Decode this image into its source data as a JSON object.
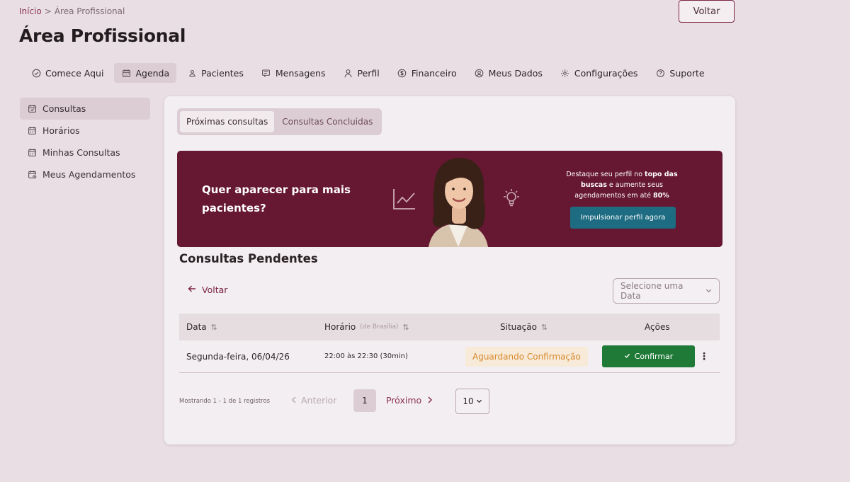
{
  "breadcrumb": {
    "home": "Início",
    "sep": ">",
    "current": "Área Profissional"
  },
  "header": {
    "title": "Área Profissional",
    "back_button": "Voltar"
  },
  "topnav": [
    {
      "label": "Comece Aqui",
      "icon": "check-circle-icon"
    },
    {
      "label": "Agenda",
      "icon": "calendar-icon",
      "active": true
    },
    {
      "label": "Pacientes",
      "icon": "user-icon"
    },
    {
      "label": "Mensagens",
      "icon": "message-icon"
    },
    {
      "label": "Perfil",
      "icon": "profile-icon"
    },
    {
      "label": "Financeiro",
      "icon": "dollar-icon"
    },
    {
      "label": "Meus Dados",
      "icon": "user-circle-icon"
    },
    {
      "label": "Configurações",
      "icon": "gear-icon"
    },
    {
      "label": "Suporte",
      "icon": "help-icon"
    }
  ],
  "sidebar": [
    {
      "label": "Consultas",
      "icon": "calendar-check-icon",
      "active": true
    },
    {
      "label": "Horários",
      "icon": "calendar-icon"
    },
    {
      "label": "Minhas Consultas",
      "icon": "calendar-icon"
    },
    {
      "label": "Meus Agendamentos",
      "icon": "calendar-clock-icon"
    }
  ],
  "tabs": [
    {
      "label": "Próximas consultas",
      "active": true
    },
    {
      "label": "Consultas Concluidas"
    }
  ],
  "banner": {
    "headline": "Quer aparecer para mais pacientes?",
    "desc_part1": "Destaque seu perfil no ",
    "desc_bold1": "topo das buscas",
    "desc_part2": " e aumente seus agendamentos em até ",
    "desc_bold2": "80%",
    "cta": "Impulsionar perfil agora",
    "color": "#661732"
  },
  "section": {
    "title": "Consultas Pendentes",
    "back_link": "Voltar",
    "date_select_placeholder": "Selecione uma Data"
  },
  "table": {
    "headers": {
      "data": "Data",
      "horario": "Horário",
      "horario_note": "(de Brasília)",
      "situacao": "Situação",
      "acoes": "Ações"
    },
    "rows": [
      {
        "data": "Segunda-feira, 06/04/26",
        "horario": "22:00 às 22:30 (30min)",
        "situacao": "Aguardando Confirmação",
        "acao": "Confirmar"
      }
    ]
  },
  "pagination": {
    "info": "Mostrando 1 - 1 de 1 registros",
    "prev": "Anterior",
    "current_page": "1",
    "next": "Próximo",
    "page_size": "10"
  }
}
